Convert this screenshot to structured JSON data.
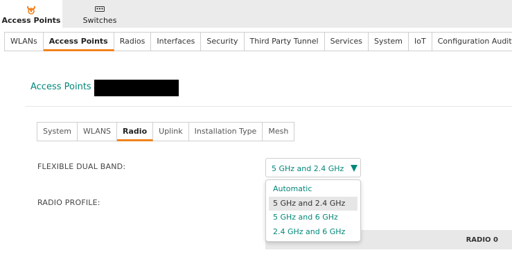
{
  "top_tabs": [
    {
      "label": "Access Points",
      "icon": "access-point-icon",
      "active": true
    },
    {
      "label": "Switches",
      "icon": "switch-icon",
      "active": false
    }
  ],
  "nav_tabs": [
    "WLANs",
    "Access Points",
    "Radios",
    "Interfaces",
    "Security",
    "Third Party Tunnel",
    "Services",
    "System",
    "IoT",
    "Configuration Audit"
  ],
  "nav_active": "Access Points",
  "breadcrumb": {
    "root": "Access Points",
    "separator": "/"
  },
  "sub_tabs": [
    "System",
    "WLANS",
    "Radio",
    "Uplink",
    "Installation Type",
    "Mesh"
  ],
  "sub_active": "Radio",
  "fields": {
    "flexible_dual_band_label": "FLEXIBLE DUAL BAND:",
    "radio_profile_label": "RADIO PROFILE:"
  },
  "select": {
    "value": "5 GHz and 2.4 GHz",
    "options": [
      "Automatic",
      "5 GHz and 2.4 GHz",
      "5 GHz and 6 GHz",
      "2.4 GHz and 6 GHz"
    ]
  },
  "radio_header": {
    "label": "RADIO 0"
  },
  "colors": {
    "accent": "#00877a",
    "active_underline": "#f0821e",
    "brand": "#f0821e"
  }
}
